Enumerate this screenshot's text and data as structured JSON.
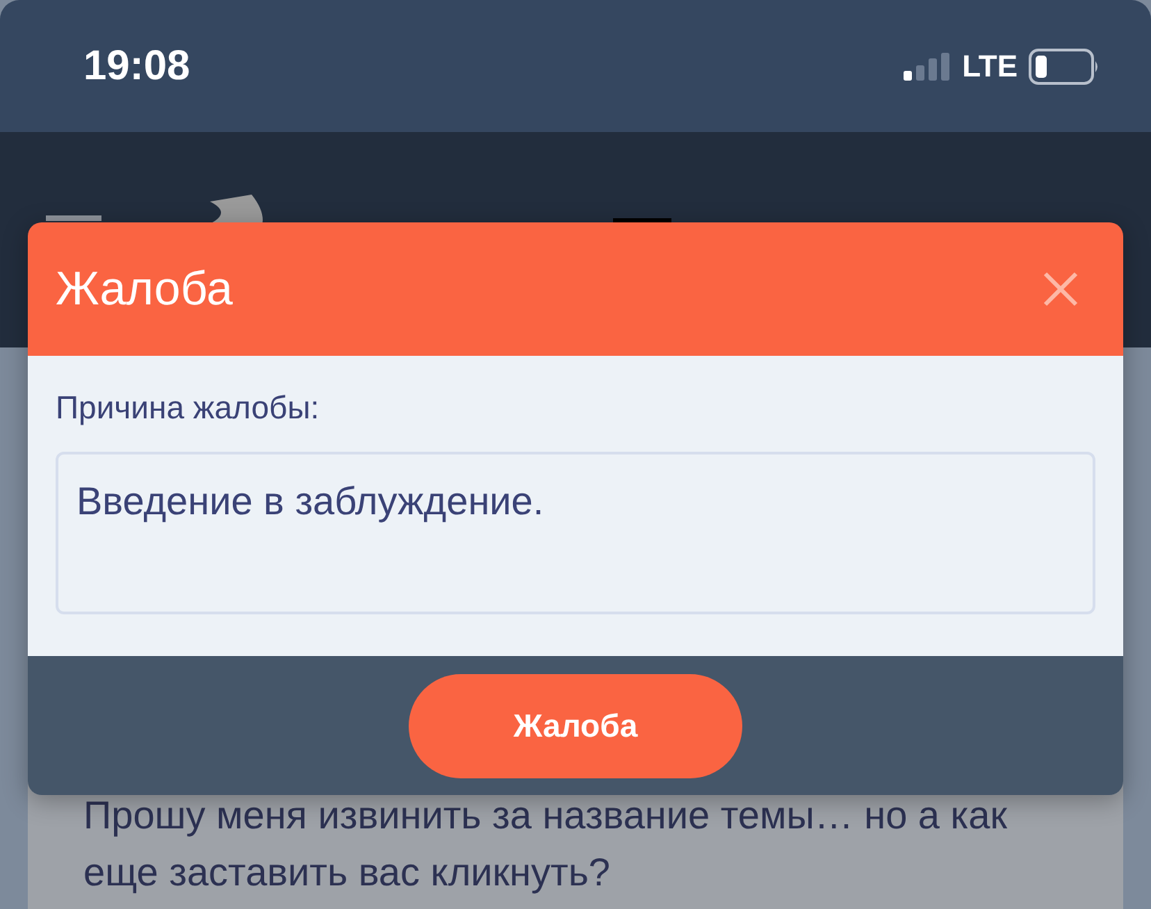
{
  "status_bar": {
    "time": "19:08",
    "network": "LTE"
  },
  "dialog": {
    "title": "Жалоба",
    "field_label": "Причина жалобы:",
    "reason": {
      "value": "Введение в заблуждение."
    },
    "submit_button": "Жалоба"
  },
  "background_post": {
    "text": "Прошу меня извинить за название темы… но а как еще заставить вас кликнуть?"
  }
}
